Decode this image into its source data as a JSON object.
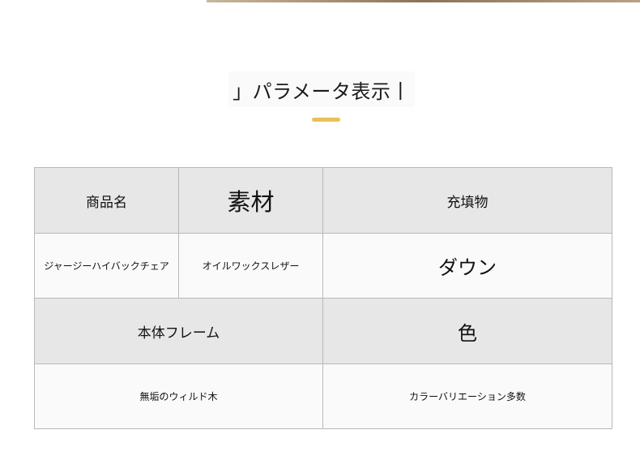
{
  "heading": {
    "text": "」パラメータ表示丨"
  },
  "colors": {
    "accent": "#e9c15a",
    "grid_border": "#b9b9b9",
    "header_bg": "#e7e7e7",
    "value_bg": "#fafafa"
  },
  "table": {
    "row1": {
      "product_name_label": "商品名",
      "material_label": "素材",
      "filling_label": "充填物"
    },
    "row2": {
      "product_name_value": "ジャージーハイバックチェア",
      "material_value": "オイルワックスレザー",
      "filling_value": "ダウン"
    },
    "row3": {
      "frame_label": "本体フレーム",
      "color_label": "色"
    },
    "row4": {
      "frame_value": "無垢のウィルド木",
      "color_value": "カラーバリエーション多数"
    }
  }
}
